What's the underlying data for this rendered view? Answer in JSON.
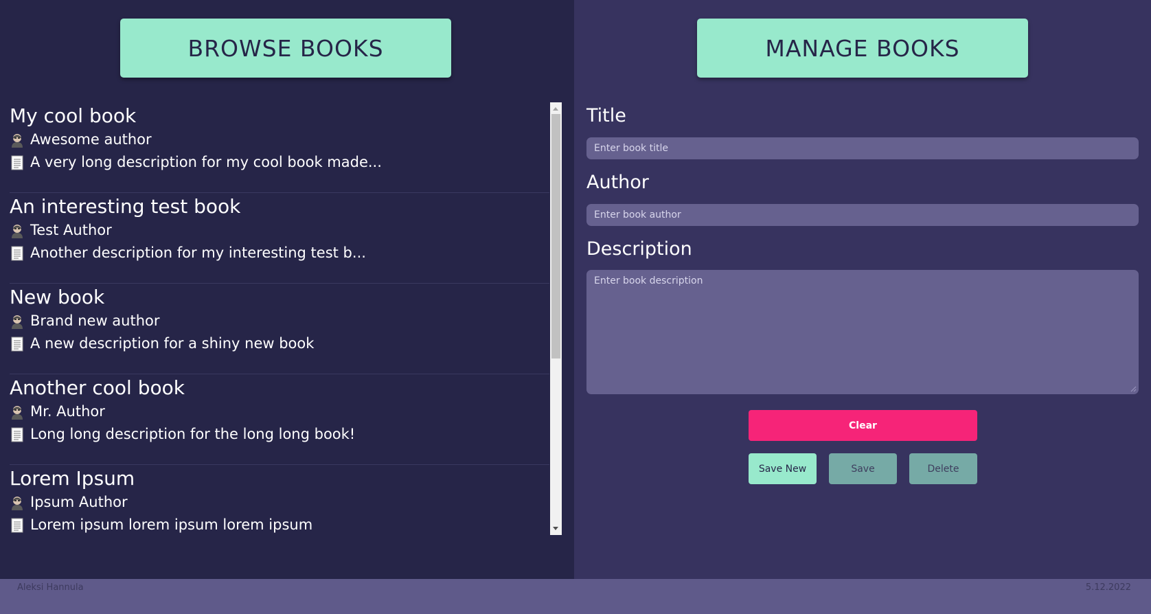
{
  "browse": {
    "header_label": "BROWSE BOOKS",
    "books": [
      {
        "title": "My cool book",
        "author": "Awesome author",
        "description": "A very long description for my cool book made..."
      },
      {
        "title": "An interesting test book",
        "author": "Test Author",
        "description": "Another description for my interesting test b..."
      },
      {
        "title": "New book",
        "author": "Brand new author",
        "description": "A new description for a shiny new book"
      },
      {
        "title": "Another cool book",
        "author": "Mr. Author",
        "description": "Long long description for the long long book!"
      },
      {
        "title": "Lorem Ipsum",
        "author": "Ipsum Author",
        "description": "Lorem ipsum lorem ipsum lorem ipsum"
      }
    ],
    "author_icon": "person-icon",
    "description_icon": "document-icon"
  },
  "manage": {
    "header_label": "MANAGE BOOKS",
    "title_label": "Title",
    "title_placeholder": "Enter book title",
    "author_label": "Author",
    "author_placeholder": "Enter book author",
    "description_label": "Description",
    "description_placeholder": "Enter book description",
    "clear_label": "Clear",
    "save_new_label": "Save New",
    "save_label": "Save",
    "delete_label": "Delete"
  },
  "footer": {
    "author": "Aleksi Hannula",
    "date": "5.12.2022"
  },
  "colors": {
    "left_bg": "#262548",
    "right_bg": "#37335f",
    "footer_bg": "#5f5a8a",
    "accent_mint": "#98e9cc",
    "clear_pink": "#f62478",
    "disabled_teal": "#76aaa6",
    "input_bg": "#66618f"
  }
}
